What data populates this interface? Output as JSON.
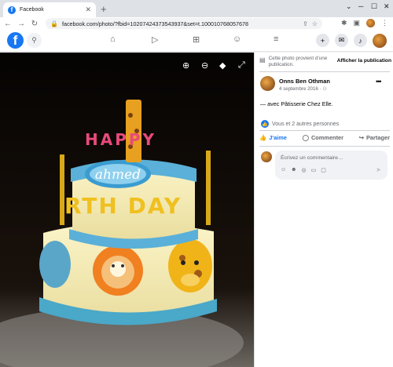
{
  "browser": {
    "tab_title": "Facebook",
    "url": "facebook.com/photo/?fbid=10207424373543937&set=t.100010768057678"
  },
  "panel": {
    "info_text": "Cette photo provient d'une publication.",
    "info_link": "Afficher la publication",
    "author_name": "Onns Ben Othman",
    "post_date": "4 septembre 2016 ·",
    "caption": "— avec Pâtisserie Chez Elle.",
    "reactions_text": "Vous et 2 autres personnes",
    "like_label": "J'aime",
    "comment_label": "Commenter",
    "share_label": "Partager",
    "comment_placeholder": "Écrivez un commentaire…"
  },
  "photo": {
    "cake_name": "ahmed",
    "candles_top": "HAPPY",
    "candles_mid": "RTH DAY"
  },
  "colors": {
    "facebook_blue": "#1877f2",
    "viewer_bg": "#000000"
  }
}
